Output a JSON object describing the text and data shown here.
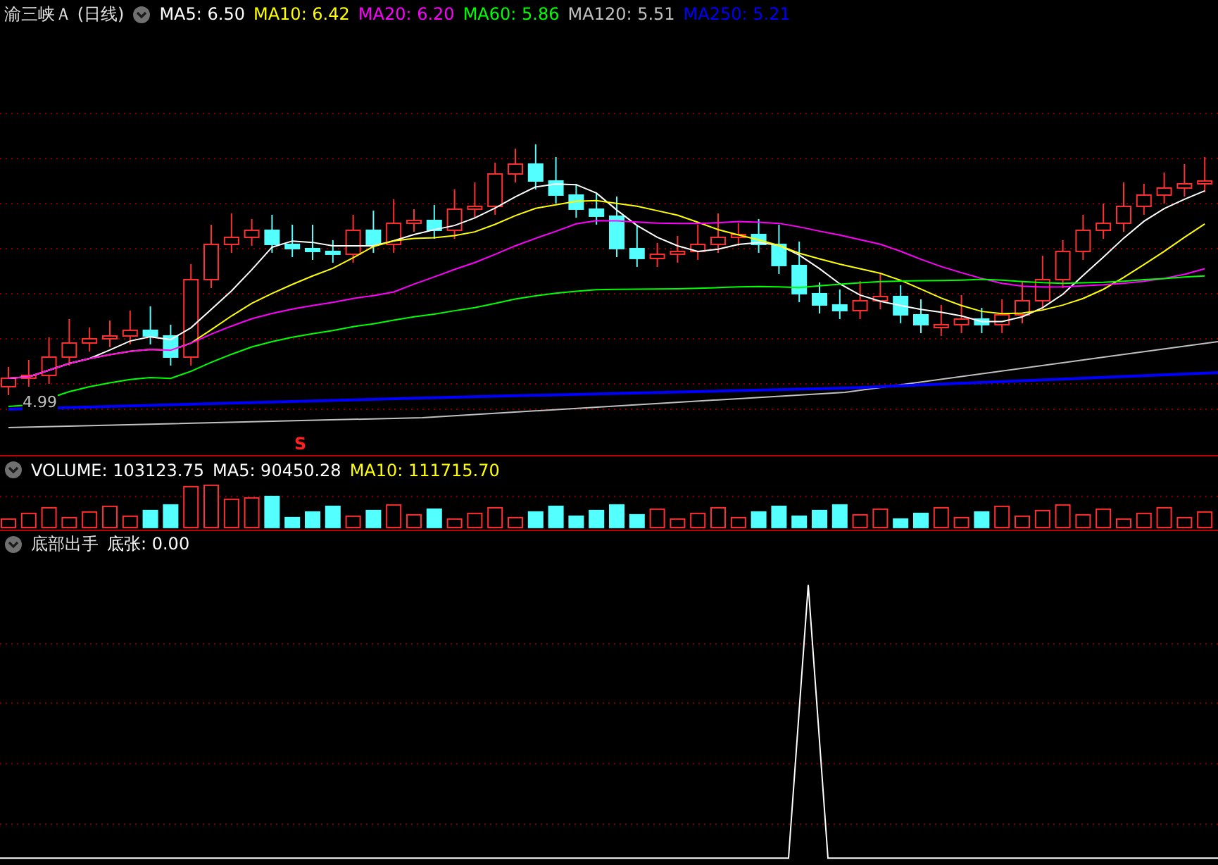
{
  "title": {
    "name": "渝三峡Ａ",
    "period": "(日线)"
  },
  "price_indicators": [
    {
      "label": "MA5: 6.50",
      "color": "#ffffff"
    },
    {
      "label": "MA10: 6.42",
      "color": "#ffff00"
    },
    {
      "label": "MA20: 6.20",
      "color": "#ff00ff"
    },
    {
      "label": "MA60: 5.86",
      "color": "#00ff00"
    },
    {
      "label": "MA120: 5.51",
      "color": "#c0c0c0"
    },
    {
      "label": "MA250: 5.21",
      "color": "#0000ff"
    }
  ],
  "low_label": "4.99",
  "signal_mark": "S",
  "volume": {
    "items": [
      {
        "label": "VOLUME: 103123.75",
        "color": "#ffffff"
      },
      {
        "label": "MA5: 90450.28",
        "color": "#ffffff"
      },
      {
        "label": "MA10: 111715.70",
        "color": "#ffff00"
      }
    ]
  },
  "indicator": {
    "name": "底部出手",
    "items": [
      {
        "label": "底张: 0.00",
        "color": "#ffffff"
      }
    ]
  }
}
